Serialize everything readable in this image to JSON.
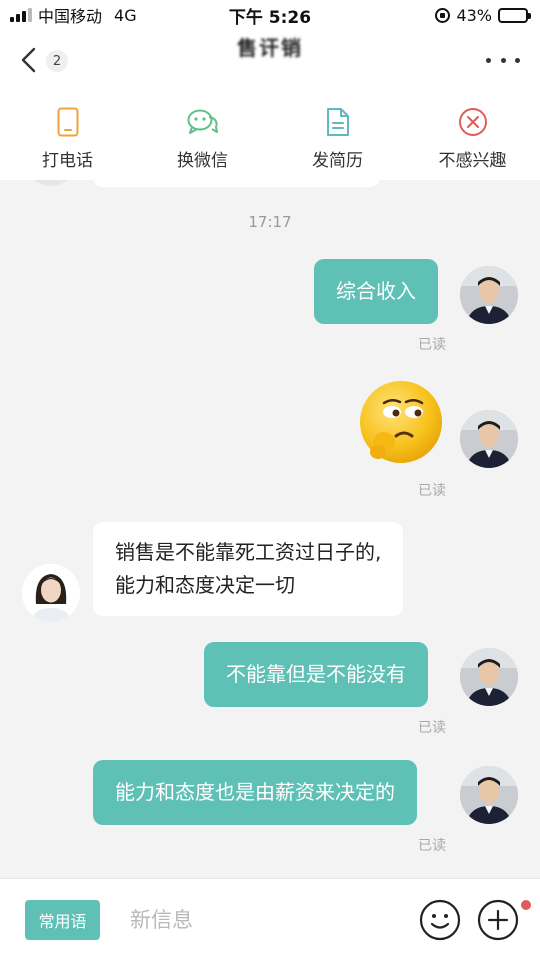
{
  "status_bar": {
    "carrier": "中国移动",
    "network": "4G",
    "time": "下午 5:26",
    "battery_percent": "43%",
    "battery_level": 0.43
  },
  "header": {
    "back_icon": "chevron-left-icon",
    "unread_count": "2",
    "title": "售讦销",
    "more_icon": "more-horizontal-icon"
  },
  "actions": [
    {
      "label": "打电话",
      "icon": "phone-icon",
      "color": "#f0a33a"
    },
    {
      "label": "换微信",
      "icon": "wechat-icon",
      "color": "#5fc08a"
    },
    {
      "label": "发简历",
      "icon": "resume-icon",
      "color": "#5fb9c2"
    },
    {
      "label": "不感兴趣",
      "icon": "close-circle-icon",
      "color": "#e25b5b"
    }
  ],
  "chat": {
    "timestamp": "17:17",
    "messages": [
      {
        "from": "me",
        "text": "综合收入",
        "read": "已读"
      },
      {
        "from": "me",
        "type": "sticker",
        "icon": "thinking-emoji-icon",
        "read": "已读"
      },
      {
        "from": "other",
        "lines": [
          "销售是不能靠死工资过日子的,",
          "能力和态度决定一切"
        ]
      },
      {
        "from": "me",
        "text": "不能靠但是不能没有",
        "read": "已读"
      },
      {
        "from": "me",
        "text": "能力和态度也是由薪资来决定的",
        "read": "已读"
      }
    ]
  },
  "input_bar": {
    "phrases_label": "常用语",
    "placeholder": "新信息",
    "value": "",
    "emoji_icon": "smiley-icon",
    "plus_icon": "plus-circle-icon"
  },
  "colors": {
    "accent": "#5fc0b6",
    "background": "#f3f3f3",
    "notification_dot": "#e25b5b"
  }
}
